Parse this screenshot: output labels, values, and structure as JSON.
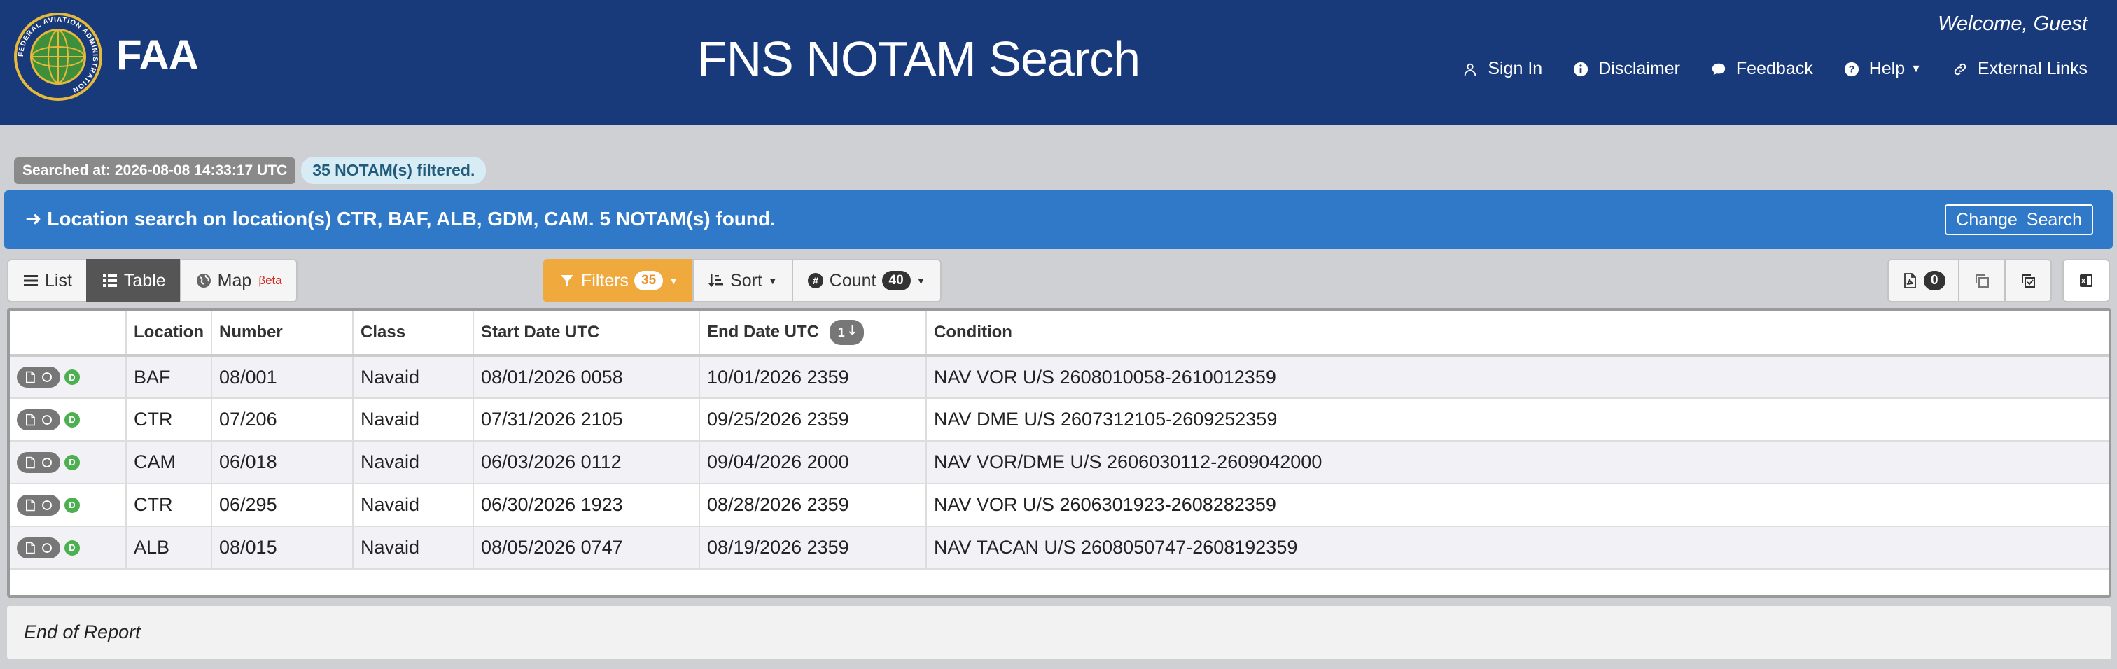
{
  "header": {
    "logo_text": "FAA",
    "seal_text": "FEDERAL AVIATION ADMINISTRATION",
    "title": "FNS NOTAM Search",
    "welcome": "Welcome, Guest",
    "nav": {
      "sign_in": "Sign In",
      "disclaimer": "Disclaimer",
      "feedback": "Feedback",
      "help": "Help",
      "external_links": "External Links"
    }
  },
  "status": {
    "searched_at": "Searched at: 2026-08-08 14:33:17 UTC",
    "filtered": "35 NOTAM(s) filtered."
  },
  "infobar": {
    "message": "Location search on location(s) CTR, BAF, ALB, GDM, CAM. 5 NOTAM(s) found.",
    "change_search": "Change Search"
  },
  "toolbar": {
    "list": "List",
    "table": "Table",
    "map": "Map",
    "map_beta": "βeta",
    "filters": "Filters",
    "filters_count": "35",
    "sort": "Sort",
    "count": "Count",
    "count_value": "40",
    "pdf_count": "0"
  },
  "table": {
    "headers": {
      "location": "Location",
      "number": "Number",
      "class": "Class",
      "start": "Start Date UTC",
      "end": "End Date UTC",
      "end_sort": "1",
      "condition": "Condition"
    },
    "rows": [
      {
        "location": "BAF",
        "number": "08/001",
        "class": "Navaid",
        "start": "08/01/2026 0058",
        "end": "10/01/2026 2359",
        "condition": "NAV VOR U/S 2608010058-2610012359",
        "badge": "D"
      },
      {
        "location": "CTR",
        "number": "07/206",
        "class": "Navaid",
        "start": "07/31/2026 2105",
        "end": "09/25/2026 2359",
        "condition": "NAV DME U/S 2607312105-2609252359",
        "badge": "D"
      },
      {
        "location": "CAM",
        "number": "06/018",
        "class": "Navaid",
        "start": "06/03/2026 0112",
        "end": "09/04/2026 2000",
        "condition": "NAV VOR/DME U/S 2606030112-2609042000",
        "badge": "D"
      },
      {
        "location": "CTR",
        "number": "06/295",
        "class": "Navaid",
        "start": "06/30/2026 1923",
        "end": "08/28/2026 2359",
        "condition": "NAV VOR U/S 2606301923-2608282359",
        "badge": "D"
      },
      {
        "location": "ALB",
        "number": "08/015",
        "class": "Navaid",
        "start": "08/05/2026 0747",
        "end": "08/19/2026 2359",
        "condition": "NAV TACAN U/S 2608050747-2608192359",
        "badge": "D"
      }
    ]
  },
  "footer": {
    "text": "End of Report"
  },
  "colors": {
    "header_bg": "#193a7a",
    "infobar_bg": "#2f79c8",
    "filter_orange": "#f0a93c",
    "badge_green": "#4caf50"
  }
}
